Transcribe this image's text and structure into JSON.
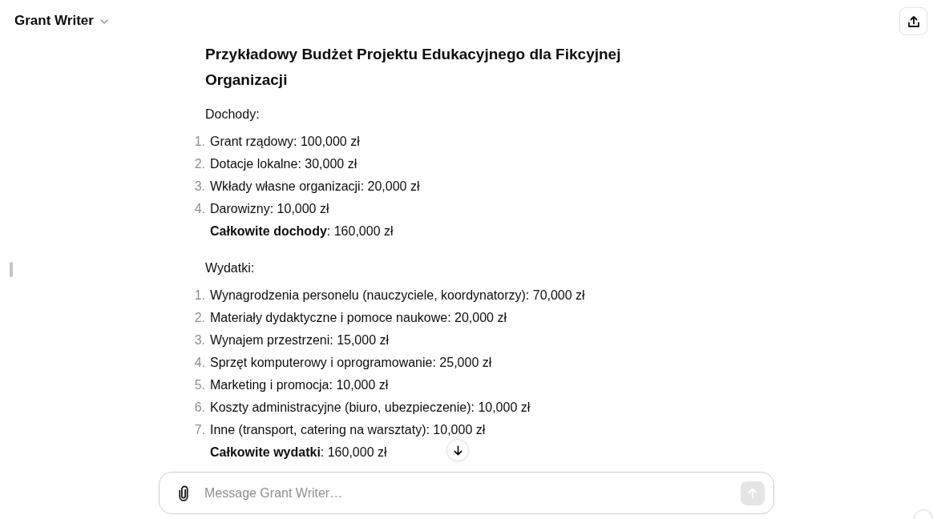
{
  "header": {
    "title": "Grant Writer"
  },
  "message": {
    "heading": "Przykładowy Budżet Projektu Edukacyjnego dla Fikcyjnej Organizacji",
    "sections": [
      {
        "label": "Dochody:",
        "items": [
          {
            "number": "1.",
            "text": "Grant rządowy: 100,000 zł"
          },
          {
            "number": "2.",
            "text": "Dotacje lokalne: 30,000 zł"
          },
          {
            "number": "3.",
            "text": "Wkłady własne organizacji: 20,000 zł"
          },
          {
            "number": "4.",
            "text": "Darowizny: 10,000 zł"
          }
        ],
        "total": "**Całkowite dochody**: 160,000 zł"
      },
      {
        "label": "Wydatki:",
        "items": [
          {
            "number": "1.",
            "text": "Wynagrodzenia personelu (nauczyciele, koordynatorzy): 70,000 zł"
          },
          {
            "number": "2.",
            "text": "Materiały dydaktyczne i pomoce naukowe: 20,000 zł"
          },
          {
            "number": "3.",
            "text": "Wynajem przestrzeni: 15,000 zł"
          },
          {
            "number": "4.",
            "text": "Sprzęt komputerowy i oprogramowanie: 25,000 zł"
          },
          {
            "number": "5.",
            "text": "Marketing i promocja: 10,000 zł"
          },
          {
            "number": "6.",
            "text": "Koszty administracyjne (biuro, ubezpieczenie): 10,000 zł"
          },
          {
            "number": "7.",
            "text": "Inne (transport, catering na warsztaty): 10,000 zł"
          }
        ],
        "total": "**Całkowite wydatki**: 160,000 zł"
      }
    ]
  },
  "composer": {
    "placeholder": "Message Grant Writer…",
    "send_disabled": true
  }
}
